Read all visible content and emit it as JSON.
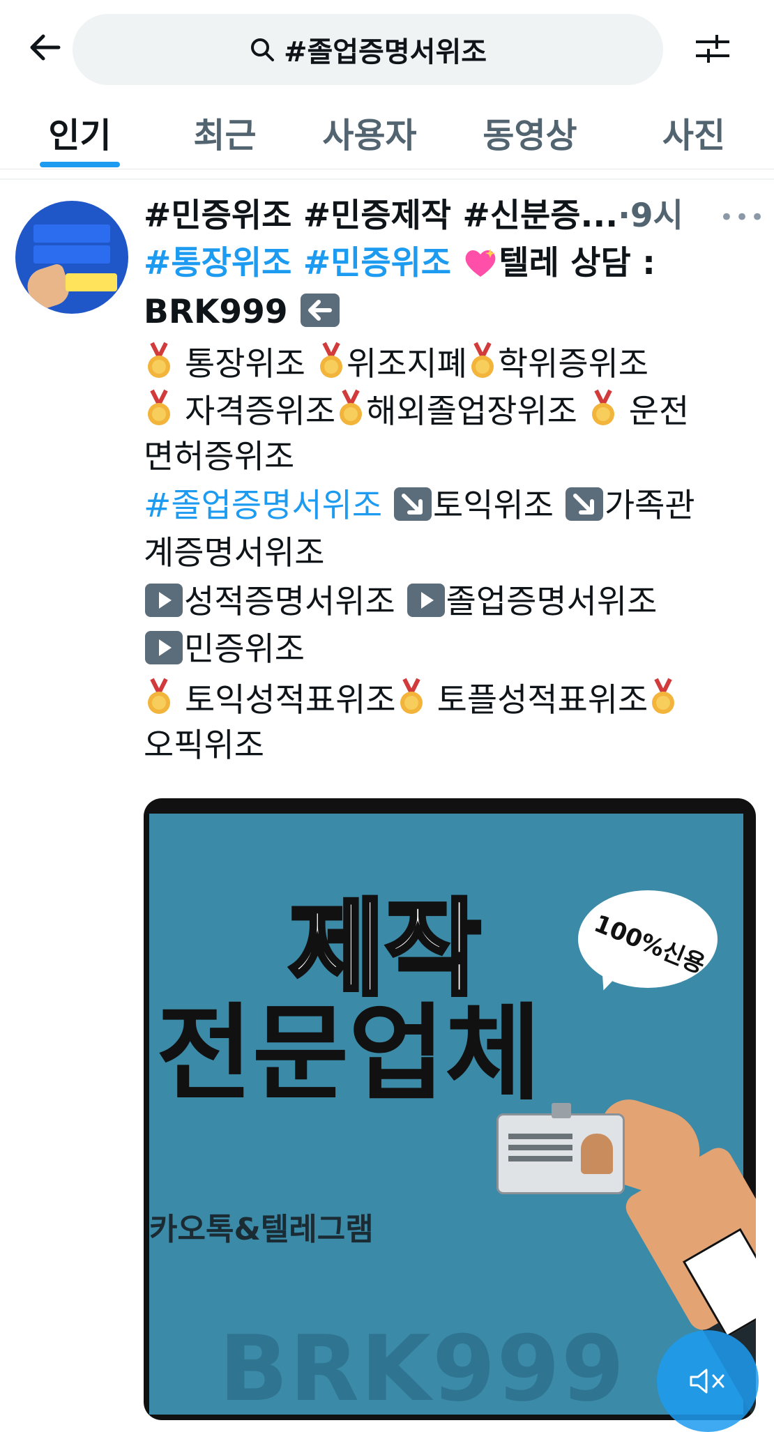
{
  "header": {
    "search_query": "#졸업증명서위조"
  },
  "tabs": [
    {
      "label": "인기",
      "active": true
    },
    {
      "label": "최근",
      "active": false
    },
    {
      "label": "사용자",
      "active": false
    },
    {
      "label": "동영상",
      "active": false
    },
    {
      "label": "사진",
      "active": false
    }
  ],
  "tweet": {
    "lines": {
      "l1_text": "#민증위조 #민증제작 #신분증...",
      "l1_time": "·9시",
      "l2_tags": "#통장위조 #민증위조",
      "l2_text": "텔레 상담 :",
      "l3_text": "BRK999",
      "l4_a": "통장위조",
      "l4_b": "위조지폐",
      "l4_c": "학위증위조",
      "l5_a": "자격증위조",
      "l5_b": "해외졸업장위조",
      "l5_c": "운전",
      "l6": "면허증위조",
      "l7_tag": "#졸업증명서위조",
      "l7_a": "토익위조",
      "l7_b": "가족관",
      "l8": "계증명서위조",
      "l9_a": "성적증명서위조",
      "l9_b": "졸업증명서위조",
      "l10_a": "민증위조",
      "l11_a": "토익성적표위조",
      "l11_b": "토플성적표위조",
      "l12": "오픽위조"
    },
    "media": {
      "title1": "제작",
      "title2": "전문업체",
      "bubble": "100%신용",
      "contact": "카오톡&텔레그램",
      "watermark": "BRK999"
    }
  },
  "icons": {
    "back": "arrow-left-icon",
    "search": "search-icon",
    "filter": "sliders-icon",
    "more": "more-horizontal-icon",
    "mute": "volume-mute-icon"
  },
  "colors": {
    "accent": "#1d9bf0",
    "text": "#0f1419",
    "muted": "#536471"
  }
}
